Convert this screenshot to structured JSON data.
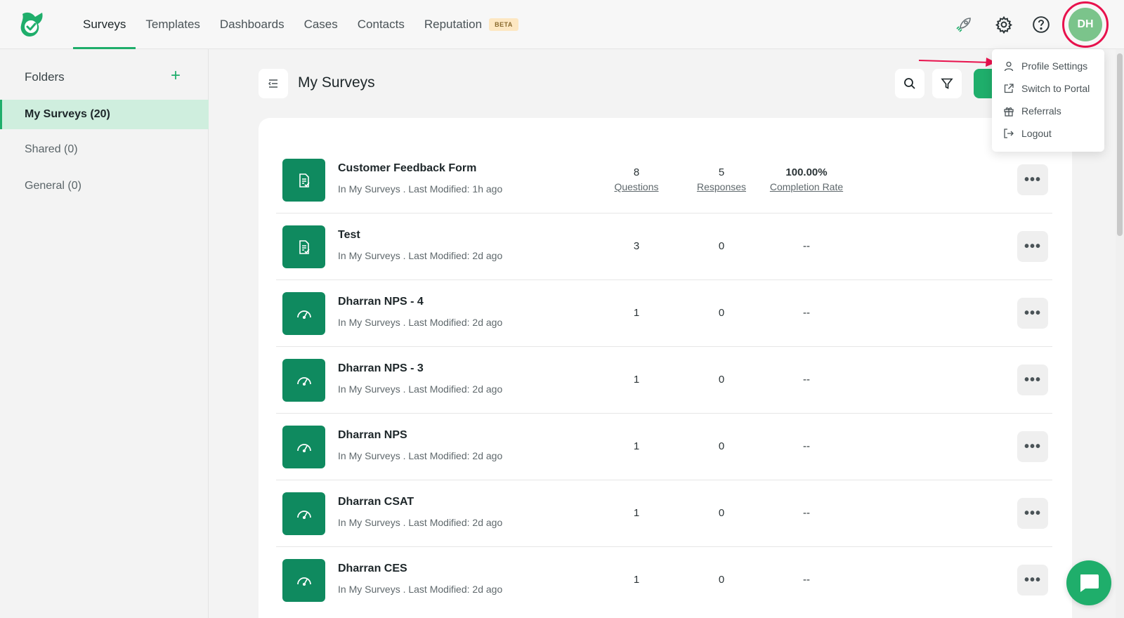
{
  "nav": {
    "items": [
      {
        "label": "Surveys",
        "active": true
      },
      {
        "label": "Templates"
      },
      {
        "label": "Dashboards"
      },
      {
        "label": "Cases"
      },
      {
        "label": "Contacts"
      },
      {
        "label": "Reputation"
      }
    ],
    "beta_label": "BETA"
  },
  "header": {
    "icons": [
      "rocket-icon",
      "gear-icon",
      "help-icon"
    ],
    "avatar_initials": "DH"
  },
  "sidebar": {
    "title": "Folders",
    "add_symbol": "+",
    "folders": [
      {
        "label": "My Surveys (20)",
        "active": true
      },
      {
        "label": "Shared (0)"
      },
      {
        "label": "General (0)"
      }
    ]
  },
  "main": {
    "title": "My Surveys"
  },
  "survey_columns": {
    "questions_label": "Questions",
    "responses_label": "Responses",
    "completion_label": "Completion Rate"
  },
  "surveys": [
    {
      "name": "Customer Feedback Form",
      "meta": "In My Surveys . Last Modified: 1h ago",
      "questions": "8",
      "responses": "5",
      "completion": "100.00%",
      "icon": "form-icon",
      "show_labels": true
    },
    {
      "name": "Test",
      "meta": "In My Surveys . Last Modified: 2d ago",
      "questions": "3",
      "responses": "0",
      "completion": "--",
      "icon": "form-icon"
    },
    {
      "name": "Dharran NPS - 4",
      "meta": "In My Surveys . Last Modified: 2d ago",
      "questions": "1",
      "responses": "0",
      "completion": "--",
      "icon": "gauge-icon"
    },
    {
      "name": "Dharran NPS - 3",
      "meta": "In My Surveys . Last Modified: 2d ago",
      "questions": "1",
      "responses": "0",
      "completion": "--",
      "icon": "gauge-icon"
    },
    {
      "name": "Dharran NPS",
      "meta": "In My Surveys . Last Modified: 2d ago",
      "questions": "1",
      "responses": "0",
      "completion": "--",
      "icon": "gauge-icon"
    },
    {
      "name": "Dharran CSAT",
      "meta": "In My Surveys . Last Modified: 2d ago",
      "questions": "1",
      "responses": "0",
      "completion": "--",
      "icon": "gauge-icon"
    },
    {
      "name": "Dharran CES",
      "meta": "In My Surveys . Last Modified: 2d ago",
      "questions": "1",
      "responses": "0",
      "completion": "--",
      "icon": "gauge-icon"
    }
  ],
  "profile_menu": {
    "items": [
      {
        "label": "Profile Settings",
        "icon": "user-icon"
      },
      {
        "label": "Switch to Portal",
        "icon": "external-link-icon"
      },
      {
        "label": "Referrals",
        "icon": "gift-icon"
      },
      {
        "label": "Logout",
        "icon": "logout-icon"
      }
    ]
  },
  "colors": {
    "accent": "#1fae6b",
    "icon_tile": "#0f8a5f",
    "highlight_ring": "#e8124d"
  }
}
